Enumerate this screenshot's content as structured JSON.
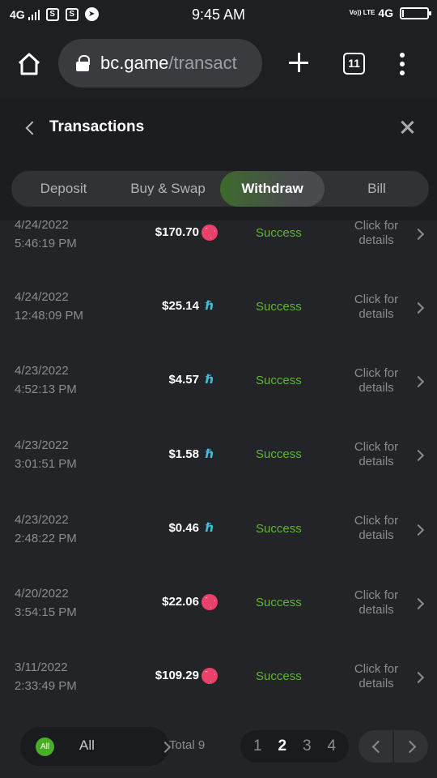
{
  "status_bar": {
    "network_left": "4G",
    "time": "9:45 AM",
    "volte": "Vo)) LTE",
    "network_right": "4G",
    "app_icons": [
      "s-app-icon",
      "s-app-icon",
      "telegram-icon"
    ]
  },
  "browser": {
    "url_host": "bc.game",
    "url_path": "/transact",
    "tab_count": "11"
  },
  "modal": {
    "title": "Transactions",
    "tabs": [
      {
        "label": "Deposit",
        "active": false
      },
      {
        "label": "Buy & Swap",
        "active": false
      },
      {
        "label": "Withdraw",
        "active": true
      },
      {
        "label": "Bill",
        "active": false
      }
    ]
  },
  "transactions": [
    {
      "date": "4/24/2022",
      "time": "5:46:19 PM",
      "amount": "$170.70",
      "coin": "trx",
      "status": "Success",
      "details": "Click for details"
    },
    {
      "date": "4/24/2022",
      "time": "12:48:09 PM",
      "amount": "$25.14",
      "coin": "hbar",
      "status": "Success",
      "details": "Click for details"
    },
    {
      "date": "4/23/2022",
      "time": "4:52:13 PM",
      "amount": "$4.57",
      "coin": "hbar",
      "status": "Success",
      "details": "Click for details"
    },
    {
      "date": "4/23/2022",
      "time": "3:01:51 PM",
      "amount": "$1.58",
      "coin": "hbar",
      "status": "Success",
      "details": "Click for details"
    },
    {
      "date": "4/23/2022",
      "time": "2:48:22 PM",
      "amount": "$0.46",
      "coin": "hbar",
      "status": "Success",
      "details": "Click for details"
    },
    {
      "date": "4/20/2022",
      "time": "3:54:15 PM",
      "amount": "$22.06",
      "coin": "trx",
      "status": "Success",
      "details": "Click for details"
    },
    {
      "date": "3/11/2022",
      "time": "2:33:49 PM",
      "amount": "$109.29",
      "coin": "trx",
      "status": "Success",
      "details": "Click for details"
    }
  ],
  "footer": {
    "filter_badge": "All",
    "filter_label": "All",
    "total": "Total 9",
    "pages": [
      "1",
      "2",
      "3",
      "4"
    ],
    "current_page": "2"
  },
  "colors": {
    "success": "#5cb82e",
    "trx_coin": "#e8416a",
    "hbar_coin": "#3fc0d6",
    "accent_green": "#49ad26"
  }
}
